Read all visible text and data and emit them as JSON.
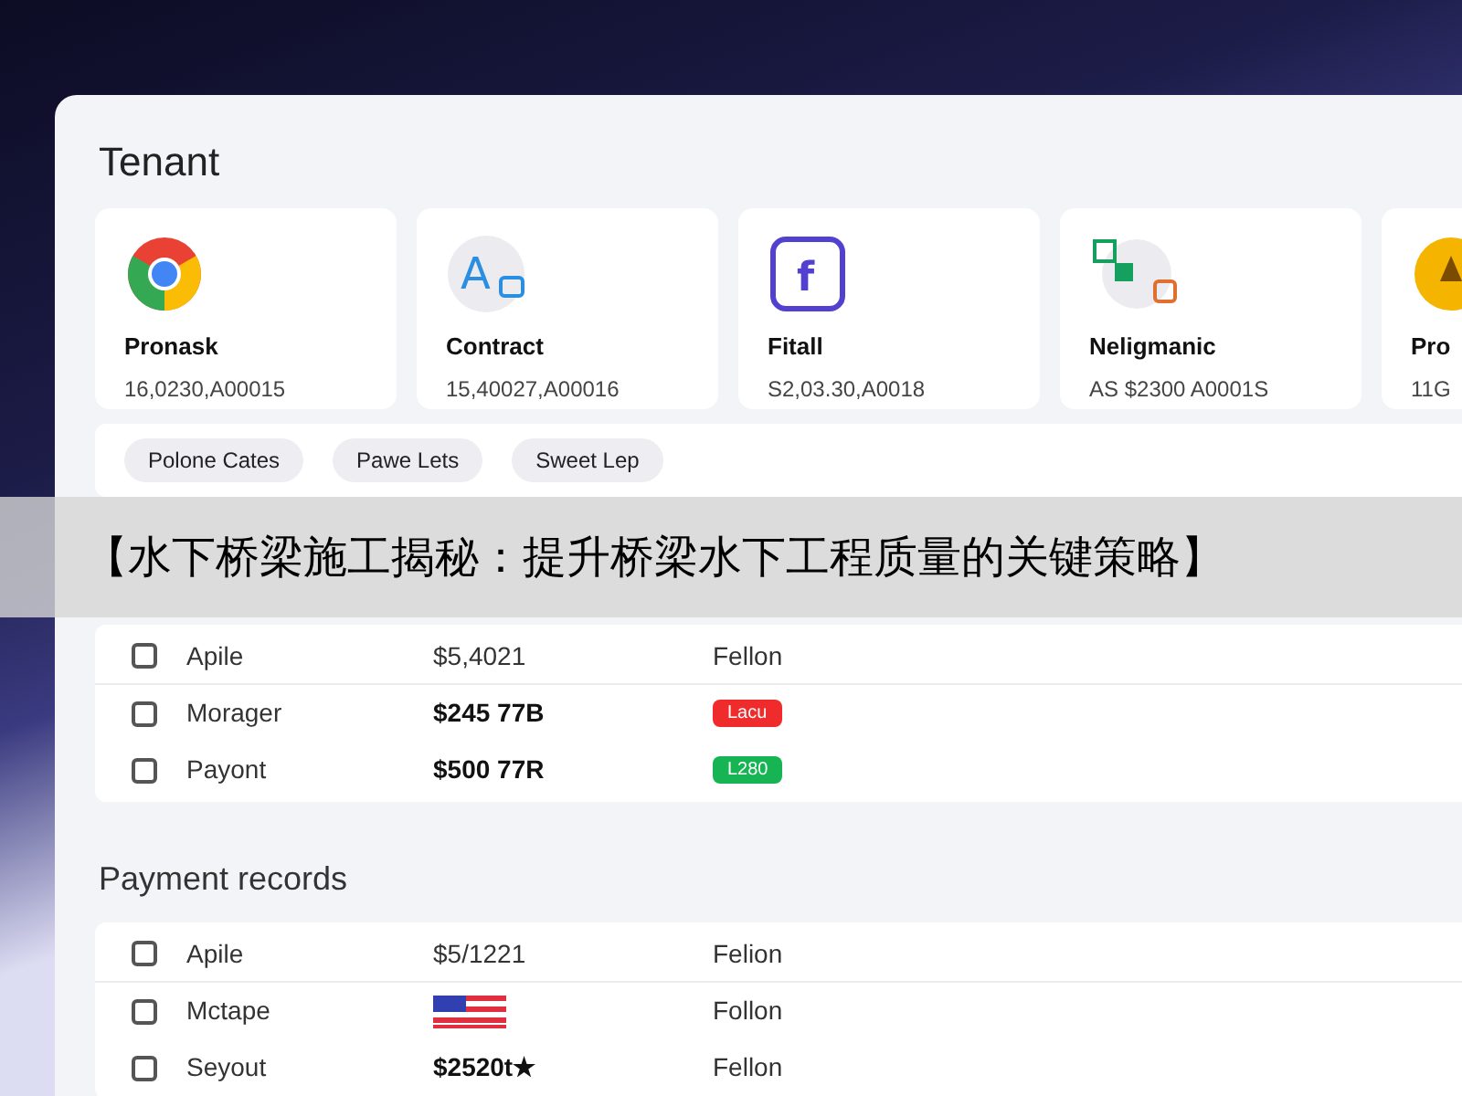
{
  "title": "Tenant",
  "cards": [
    {
      "kind": "ring",
      "name": "Pronask",
      "value": "16,0230,A00015"
    },
    {
      "kind": "letter",
      "icon_text": "A",
      "name": "Contract",
      "value": "15,40027,A00016"
    },
    {
      "kind": "square",
      "icon_text": "f",
      "name": "Fitall",
      "value": "S2,03.30,A0018"
    },
    {
      "kind": "tiles",
      "name": "Neligmanic",
      "value": "AS $2300 A0001S"
    },
    {
      "kind": "circle",
      "name": "Pro",
      "value": "11G"
    }
  ],
  "chips": [
    {
      "label": "Polone Cates"
    },
    {
      "label": "Pawe Lets"
    },
    {
      "label": "Sweet Lep"
    }
  ],
  "caption_banner": "【水下桥梁施工揭秘：提升桥梁水下工程质量的关键策略】",
  "content_rows": [
    {
      "checked": false,
      "name": "Apile",
      "amount": {
        "kind": "text",
        "text": "$5,4021"
      },
      "status": {
        "kind": "text",
        "text": "Fellon"
      }
    },
    {
      "checked": false,
      "name": "Morager",
      "amount": {
        "kind": "bold",
        "text": "$245 77B"
      },
      "status": {
        "kind": "badge",
        "text": "Lacu",
        "color": "#ef2b2b"
      }
    },
    {
      "checked": false,
      "name": "Payont",
      "amount": {
        "kind": "bold",
        "text": "$500 77R"
      },
      "status": {
        "kind": "badge",
        "text": "L280",
        "color": "#16b452"
      }
    }
  ],
  "payment_records": {
    "title": "Payment records",
    "rows": [
      {
        "checked": false,
        "name": "Apile",
        "amount": {
          "kind": "text",
          "text": "$5/1221"
        },
        "status": {
          "kind": "text",
          "text": "Felion"
        }
      },
      {
        "checked": false,
        "name": "Mctape",
        "amount": {
          "kind": "flag"
        },
        "status": {
          "kind": "text",
          "text": "Follon"
        }
      },
      {
        "checked": false,
        "name": "Seyout",
        "amount": {
          "kind": "bold",
          "text": "$2520t★"
        },
        "status": {
          "kind": "text",
          "text": "Fellon"
        }
      }
    ]
  }
}
